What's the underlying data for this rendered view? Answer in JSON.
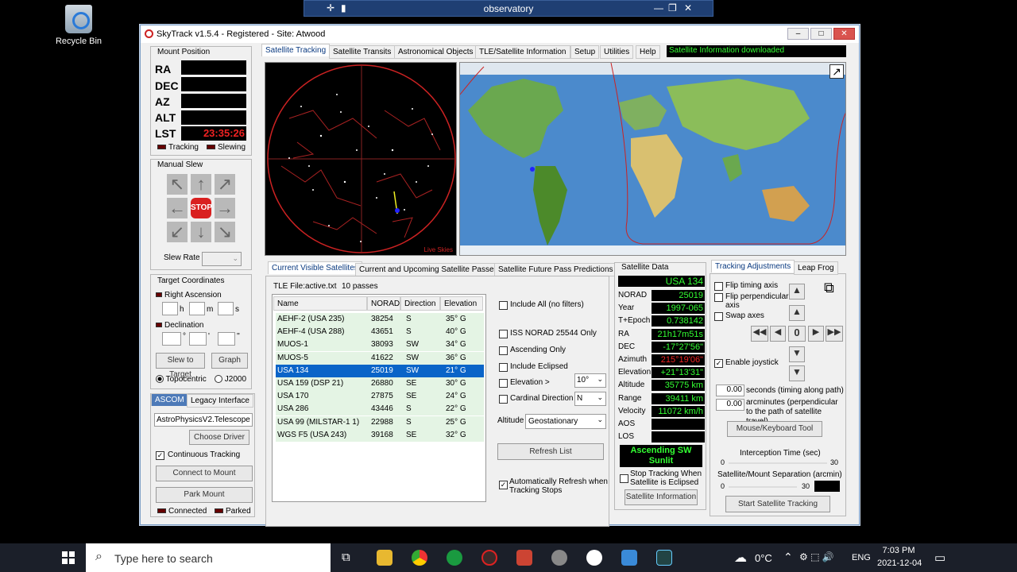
{
  "desktop": {
    "recycle_bin": "Recycle Bin"
  },
  "rdp": {
    "title": "observatory"
  },
  "window": {
    "title": "SkyTrack v1.5.4 - Registered - Site: Atwood"
  },
  "mount": {
    "title": "Mount Position",
    "labels": [
      "RA",
      "DEC",
      "AZ",
      "ALT",
      "LST"
    ],
    "lst": "23:35:26",
    "tracking": "Tracking",
    "slewing": "Slewing"
  },
  "manual_slew": {
    "title": "Manual Slew",
    "stop": "STOP",
    "slew_rate": "Slew Rate"
  },
  "target": {
    "title": "Target Coordinates",
    "ra": "Right Ascension",
    "h": "h",
    "m": "m",
    "s": "s",
    "dec": "Declination",
    "deg": "°",
    "min": "'",
    "sec": "''",
    "slew_btn": "Slew to Target",
    "graph_btn": "Graph",
    "topocentric": "Topocentric",
    "j2000": "J2000"
  },
  "driver": {
    "tab_ascom": "ASCOM",
    "tab_legacy": "Legacy Interface",
    "driver_value": "AstroPhysicsV2.Telescope",
    "choose": "Choose Driver",
    "continuous": "Continuous Tracking",
    "connect": "Connect to Mount",
    "park": "Park Mount",
    "connected": "Connected",
    "parked": "Parked"
  },
  "tabs": [
    "Satellite Tracking",
    "Satellite Transits",
    "Astronomical Objects",
    "TLE/Satellite Information",
    "Setup",
    "Utilities",
    "Help"
  ],
  "status": "Satellite Information downloaded",
  "sky": {
    "corner": "Live Skies"
  },
  "list_tabs": [
    "Current Visible Satellites",
    "Current and Upcoming Satellite Passes",
    "Satellite Future Pass Predictions"
  ],
  "tle": {
    "file": "TLE File:active.txt",
    "passes": "10 passes"
  },
  "table": {
    "headers": [
      "Name",
      "NORAD",
      "Direction",
      "Elevation"
    ],
    "rows": [
      [
        "AEHF-2 (USA 235)",
        "38254",
        "S",
        "35° G"
      ],
      [
        "AEHF-4 (USA 288)",
        "43651",
        "S",
        "40° G"
      ],
      [
        "MUOS-1",
        "38093",
        "SW",
        "34° G"
      ],
      [
        "MUOS-5",
        "41622",
        "SW",
        "36° G"
      ],
      [
        "USA 134",
        "25019",
        "SW",
        "21° G"
      ],
      [
        "USA 159 (DSP 21)",
        "26880",
        "SE",
        "30° G"
      ],
      [
        "USA 170",
        "27875",
        "SE",
        "24° G"
      ],
      [
        "USA 286",
        "43446",
        "S",
        "22° G"
      ],
      [
        "USA 99 (MILSTAR-1 1)",
        "22988",
        "S",
        "25° G"
      ],
      [
        "WGS F5 (USA 243)",
        "39168",
        "SE",
        "32° G"
      ]
    ],
    "selected": 4
  },
  "filters": {
    "include_all": "Include All (no filters)",
    "iss": "ISS NORAD 25544 Only",
    "ascending": "Ascending Only",
    "eclipsed": "Include Eclipsed",
    "elevation": "Elevation >",
    "elevation_val": "10°",
    "cardinal": "Cardinal Direction",
    "cardinal_val": "N",
    "altitude": "Altitude",
    "altitude_val": "Geostationary",
    "refresh": "Refresh List",
    "auto": "Automatically Refresh when Tracking Stops"
  },
  "sat_data": {
    "title": "Satellite Data",
    "name": "USA 134",
    "fields": [
      [
        "NORAD",
        "25019"
      ],
      [
        "Year",
        "1997-065"
      ],
      [
        "T+Epoch",
        "0.738142"
      ],
      [
        "RA",
        "21h17m51s"
      ],
      [
        "DEC",
        "-17°27'56\""
      ],
      [
        "Azimuth",
        "215°19'06\""
      ],
      [
        "Elevation",
        "+21°13'31\""
      ],
      [
        "Altitude",
        "35775 km"
      ],
      [
        "Range",
        "39411 km"
      ],
      [
        "Velocity",
        "11072 km/h"
      ],
      [
        "AOS",
        ""
      ],
      [
        "LOS",
        ""
      ]
    ],
    "status1": "Ascending  SW",
    "status2": "Sunlit",
    "stop_eclipsed": "Stop Tracking When Satellite is Eclipsed",
    "info_btn": "Satellite Information"
  },
  "adjust": {
    "tab1": "Tracking Adjustments",
    "tab2": "Leap Frog",
    "flip_timing": "Flip timing axis",
    "flip_perp": "Flip perpendicular axis",
    "swap": "Swap axes",
    "joystick": "Enable joystick",
    "zero": "0",
    "secs_val": "0.00",
    "secs_lbl": "seconds (timing along path)",
    "arc_val": "0.00",
    "arc_lbl": "arcminutes (perpendicular to the path of satellite travel)",
    "mouse_btn": "Mouse/Keyboard Tool",
    "intercept": "Interception Time (sec)",
    "i0": "0",
    "i30": "30",
    "separation": "Satellite/Mount Separation (arcmin)",
    "s0": "0",
    "s30": "30",
    "start_btn": "Start Satellite Tracking"
  },
  "taskbar": {
    "search": "Type here to search",
    "temp": "0°C",
    "lang": "ENG",
    "time": "7:03 PM",
    "date": "2021-12-04"
  }
}
